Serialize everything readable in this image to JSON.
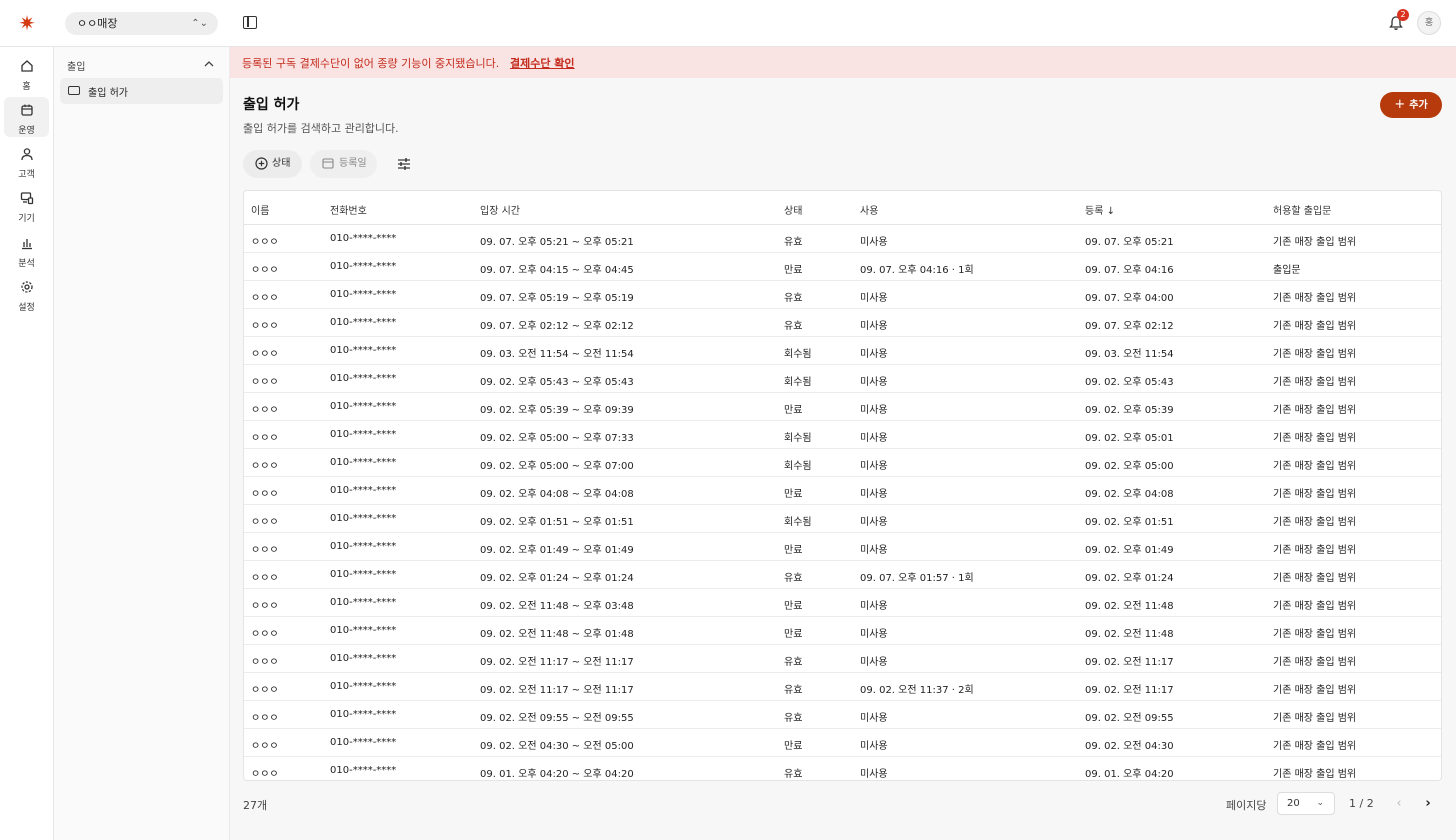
{
  "top": {
    "store": "ㅇㅇ매장",
    "notification_count": "2",
    "avatar_initial": "홍"
  },
  "rail": {
    "home": "홈",
    "ops": "운영",
    "customer": "고객",
    "device": "기기",
    "analytics": "분석",
    "settings": "설정"
  },
  "submenu": {
    "section": "출입",
    "item": "출입 허가"
  },
  "alert": {
    "message": "등록된 구독 결제수단이 없어 종량 기능이 중지됐습니다.",
    "link": "결제수단 확인"
  },
  "header": {
    "title": "출입 허가",
    "subtitle": "출입 허가를 검색하고 관리합니다.",
    "add_label": "추가"
  },
  "filters": {
    "status": "상태",
    "date": "등록일"
  },
  "table": {
    "columns": [
      "이름",
      "전화번호",
      "입장 시간",
      "상태",
      "사용",
      "등록",
      "허용할 출입문"
    ],
    "rows": [
      [
        "ㅇㅇㅇ",
        "010-****-****",
        "09. 07. 오후 05:21 ~ 오후 05:21",
        "유효",
        "미사용",
        "09. 07. 오후 05:21",
        "기존 매장 출입 범위"
      ],
      [
        "ㅇㅇㅇ",
        "010-****-****",
        "09. 07. 오후 04:15 ~ 오후 04:45",
        "만료",
        "09. 07. 오후 04:16 · 1회",
        "09. 07. 오후 04:16",
        "출입문"
      ],
      [
        "ㅇㅇㅇ",
        "010-****-****",
        "09. 07. 오후 05:19 ~ 오후 05:19",
        "유효",
        "미사용",
        "09. 07. 오후 04:00",
        "기존 매장 출입 범위"
      ],
      [
        "ㅇㅇㅇ",
        "010-****-****",
        "09. 07. 오후 02:12 ~ 오후 02:12",
        "유효",
        "미사용",
        "09. 07. 오후 02:12",
        "기존 매장 출입 범위"
      ],
      [
        "ㅇㅇㅇ",
        "010-****-****",
        "09. 03. 오전 11:54 ~ 오전 11:54",
        "회수됨",
        "미사용",
        "09. 03. 오전 11:54",
        "기존 매장 출입 범위"
      ],
      [
        "ㅇㅇㅇ",
        "010-****-****",
        "09. 02. 오후 05:43 ~ 오후 05:43",
        "회수됨",
        "미사용",
        "09. 02. 오후 05:43",
        "기존 매장 출입 범위"
      ],
      [
        "ㅇㅇㅇ",
        "010-****-****",
        "09. 02. 오후 05:39 ~ 오후 09:39",
        "만료",
        "미사용",
        "09. 02. 오후 05:39",
        "기존 매장 출입 범위"
      ],
      [
        "ㅇㅇㅇ",
        "010-****-****",
        "09. 02. 오후 05:00 ~ 오후 07:33",
        "회수됨",
        "미사용",
        "09. 02. 오후 05:01",
        "기존 매장 출입 범위"
      ],
      [
        "ㅇㅇㅇ",
        "010-****-****",
        "09. 02. 오후 05:00 ~ 오후 07:00",
        "회수됨",
        "미사용",
        "09. 02. 오후 05:00",
        "기존 매장 출입 범위"
      ],
      [
        "ㅇㅇㅇ",
        "010-****-****",
        "09. 02. 오후 04:08 ~ 오후 04:08",
        "만료",
        "미사용",
        "09. 02. 오후 04:08",
        "기존 매장 출입 범위"
      ],
      [
        "ㅇㅇㅇ",
        "010-****-****",
        "09. 02. 오후 01:51 ~ 오후 01:51",
        "회수됨",
        "미사용",
        "09. 02. 오후 01:51",
        "기존 매장 출입 범위"
      ],
      [
        "ㅇㅇㅇ",
        "010-****-****",
        "09. 02. 오후 01:49 ~ 오후 01:49",
        "만료",
        "미사용",
        "09. 02. 오후 01:49",
        "기존 매장 출입 범위"
      ],
      [
        "ㅇㅇㅇ",
        "010-****-****",
        "09. 02. 오후 01:24 ~ 오후 01:24",
        "유효",
        "09. 07. 오후 01:57 · 1회",
        "09. 02. 오후 01:24",
        "기존 매장 출입 범위"
      ],
      [
        "ㅇㅇㅇ",
        "010-****-****",
        "09. 02. 오전 11:48 ~ 오후 03:48",
        "만료",
        "미사용",
        "09. 02. 오전 11:48",
        "기존 매장 출입 범위"
      ],
      [
        "ㅇㅇㅇ",
        "010-****-****",
        "09. 02. 오전 11:48 ~ 오후 01:48",
        "만료",
        "미사용",
        "09. 02. 오전 11:48",
        "기존 매장 출입 범위"
      ],
      [
        "ㅇㅇㅇ",
        "010-****-****",
        "09. 02. 오전 11:17 ~ 오전 11:17",
        "유효",
        "미사용",
        "09. 02. 오전 11:17",
        "기존 매장 출입 범위"
      ],
      [
        "ㅇㅇㅇ",
        "010-****-****",
        "09. 02. 오전 11:17 ~ 오전 11:17",
        "유효",
        "09. 02. 오전 11:37 · 2회",
        "09. 02. 오전 11:17",
        "기존 매장 출입 범위"
      ],
      [
        "ㅇㅇㅇ",
        "010-****-****",
        "09. 02. 오전 09:55 ~ 오전 09:55",
        "유효",
        "미사용",
        "09. 02. 오전 09:55",
        "기존 매장 출입 범위"
      ],
      [
        "ㅇㅇㅇ",
        "010-****-****",
        "09. 02. 오전 04:30 ~ 오전 05:00",
        "만료",
        "미사용",
        "09. 02. 오전 04:30",
        "기존 매장 출입 범위"
      ],
      [
        "ㅇㅇㅇ",
        "010-****-****",
        "09. 01. 오후 04:20 ~ 오후 04:20",
        "유효",
        "미사용",
        "09. 01. 오후 04:20",
        "기존 매장 출입 범위"
      ]
    ]
  },
  "footer": {
    "count": "27개",
    "per_page_label": "페이지당",
    "per_page_value": "20",
    "page_info": "1 / 2"
  },
  "colors": {
    "accent": "#b63a0c",
    "alert_bg": "#f9e3e3",
    "alert_text": "#c42b1c"
  }
}
